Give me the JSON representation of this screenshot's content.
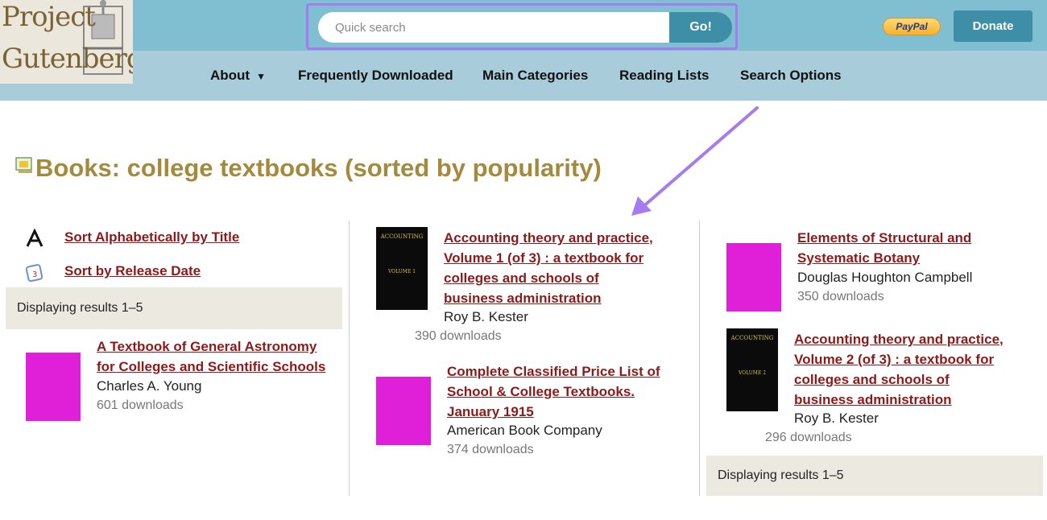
{
  "logo": {
    "line1": "Project",
    "line2": "Gutenberg"
  },
  "search": {
    "placeholder": "Quick search",
    "button": "Go!"
  },
  "paypal_label": "PayPal",
  "donate_label": "Donate",
  "nav": [
    {
      "label": "About",
      "arrow": "▼"
    },
    {
      "label": "Frequently Downloaded"
    },
    {
      "label": "Main Categories"
    },
    {
      "label": "Reading Lists"
    },
    {
      "label": "Search Options"
    }
  ],
  "page_title": "Books: college textbooks (sorted by popularity)",
  "sort": {
    "alpha": "Sort Alphabetically by Title",
    "release": "Sort by Release Date"
  },
  "results_label": "Displaying results 1–5",
  "books": [
    {
      "title": "A Textbook of General Astronomy for Colleges and Scientific Schools",
      "author": "Charles A. Young",
      "downloads": "601 downloads"
    },
    {
      "title": "Accounting theory and practice, Volume 1 (of 3) : a textbook for colleges and schools of business administration",
      "author": "Roy B. Kester",
      "downloads": "390 downloads"
    },
    {
      "title": "Complete Classified Price List of School & College Textbooks. January 1915",
      "author": "American Book Company",
      "downloads": "374 downloads"
    },
    {
      "title": "Elements of Structural and Systematic Botany",
      "author": "Douglas Houghton Campbell",
      "downloads": "350 downloads"
    },
    {
      "title": "Accounting theory and practice, Volume 2 (of 3) : a textbook for colleges and schools of business administration",
      "author": "Roy B. Kester",
      "downloads": "296 downloads"
    }
  ],
  "icons": {
    "sort_alpha": "letter-a-icon",
    "sort_release": "calendar-icon",
    "title": "books-icon",
    "annotation": "arrow-pointer"
  },
  "colors": {
    "topbar": "#7fbfd1",
    "navbar": "#a9ccda",
    "accent": "#3f8ea8",
    "title": "#a48a3c",
    "link": "#8b1a1a",
    "highlight": "#a47bf0",
    "cover_pink": "#e020d8"
  }
}
